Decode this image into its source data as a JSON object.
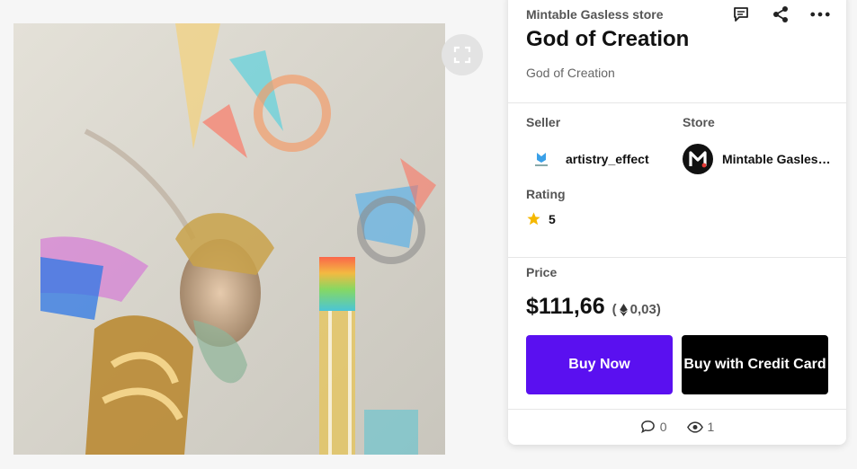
{
  "artwork": {
    "alt": "God of Creation artwork"
  },
  "header": {
    "store_name": "Mintable Gasless store",
    "title": "God of Creation",
    "description": "God of Creation",
    "icons": [
      "comment-icon",
      "share-icon",
      "more-icon"
    ]
  },
  "meta": {
    "seller_label": "Seller",
    "seller_name": "artistry_effect",
    "store_label": "Store",
    "store_name": "Mintable Gasless store",
    "rating_label": "Rating",
    "rating_value": "5"
  },
  "price": {
    "label": "Price",
    "fiat": "$111,66",
    "eth_open": "(",
    "eth_value": "0,03)",
    "buy_now_label": "Buy Now",
    "buy_card_label": "Buy with Credit Card"
  },
  "stats": {
    "comments": "0",
    "views": "1"
  },
  "colors": {
    "accent": "#5a10f0",
    "star": "#f5b800",
    "dark_button": "#000000"
  }
}
